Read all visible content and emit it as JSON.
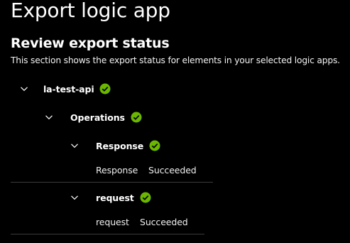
{
  "page": {
    "title": "Export logic app"
  },
  "review": {
    "title": "Review export status",
    "description": "This section shows the export status for elements in your selected logic apps."
  },
  "tree": {
    "app": {
      "label": "la-test-api",
      "status_icon": "success-check-icon",
      "expanded": true
    },
    "operations": {
      "label": "Operations",
      "status_icon": "success-check-icon",
      "expanded": true
    },
    "items": [
      {
        "label": "Response",
        "status_icon": "success-check-icon",
        "expanded": true,
        "detail_name": "Response",
        "detail_status": "Succeeded"
      },
      {
        "label": "request",
        "status_icon": "success-check-icon",
        "expanded": true,
        "detail_name": "request",
        "detail_status": "Succeeded"
      }
    ]
  },
  "colors": {
    "background": "#000000",
    "text": "#ffffff",
    "success": "#6bb700",
    "divider": "#3b3b3b"
  }
}
